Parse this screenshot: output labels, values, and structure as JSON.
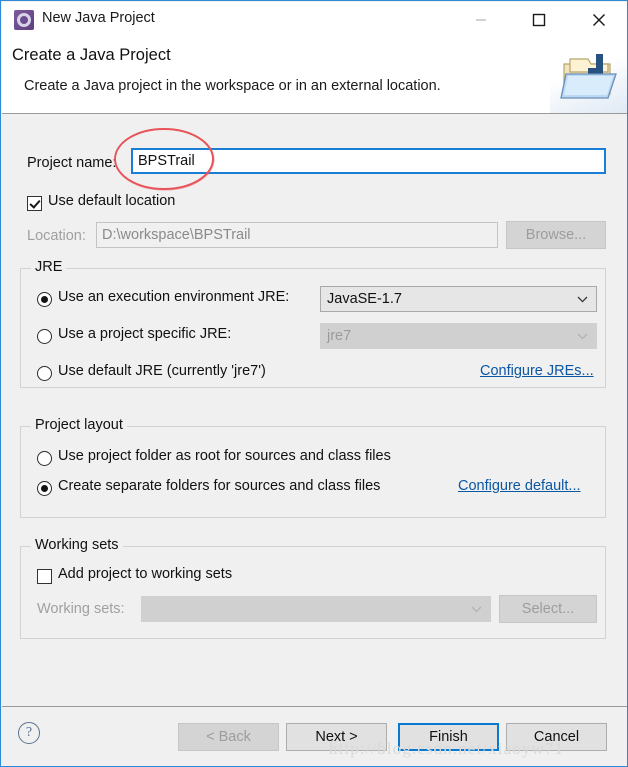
{
  "window": {
    "title": "New Java Project",
    "icon": "java-project-icon",
    "controls": {
      "minimize": "minimize-icon",
      "maximize": "maximize-icon",
      "close": "close-icon"
    }
  },
  "header": {
    "title": "Create a Java Project",
    "description": "Create a Java project in the workspace or in an external location.",
    "graphic": "java-folder-icon"
  },
  "form": {
    "project_name": {
      "label": "Project name:",
      "value": "BPSTrail",
      "placeholder": ""
    },
    "use_default_location": {
      "label": "Use default location",
      "checked": true
    },
    "location": {
      "label": "Location:",
      "value": "D:\\workspace\\BPSTrail",
      "placeholder": "",
      "enabled": false
    },
    "browse_button": {
      "label": "Browse...",
      "enabled": false
    }
  },
  "jre": {
    "group_title": "JRE",
    "options": [
      {
        "label": "Use an execution environment JRE:",
        "selected": true
      },
      {
        "label": "Use a project specific JRE:",
        "selected": false
      },
      {
        "label": "Use default JRE (currently 'jre7')",
        "selected": false
      }
    ],
    "execution_env_combo": {
      "value": "JavaSE-1.7",
      "enabled": true
    },
    "specific_jre_combo": {
      "value": "jre7",
      "enabled": false
    },
    "configure_link": "Configure JREs..."
  },
  "project_layout": {
    "group_title": "Project layout",
    "options": [
      {
        "label": "Use project folder as root for sources and class files",
        "selected": false
      },
      {
        "label": "Create separate folders for sources and class files",
        "selected": true
      }
    ],
    "configure_link": "Configure default..."
  },
  "working_sets": {
    "group_title": "Working sets",
    "add_checkbox": {
      "label": "Add project to working sets",
      "checked": false
    },
    "combo_label": "Working sets:",
    "combo_value": "",
    "select_button": "Select..."
  },
  "footer": {
    "help": "?",
    "buttons": [
      {
        "label": "< Back",
        "state": "disabled"
      },
      {
        "label": "Next >",
        "state": "normal"
      },
      {
        "label": "Finish",
        "state": "default-focus"
      },
      {
        "label": "Cancel",
        "state": "normal"
      }
    ]
  },
  "annotation": {
    "shape": "red-ellipse",
    "color": "#e8535a",
    "target": "project-name-value"
  },
  "watermark": {
    "text": "http://blog.csdn.net/xiaoyw71"
  },
  "colors": {
    "dialog_border": "#2e8ad6",
    "body_bg": "#f0f0f0",
    "header_bg": "#ffffff",
    "link": "#0b57a4",
    "focus_blue": "#0a7ad0",
    "annotation_red": "#e8535a"
  }
}
